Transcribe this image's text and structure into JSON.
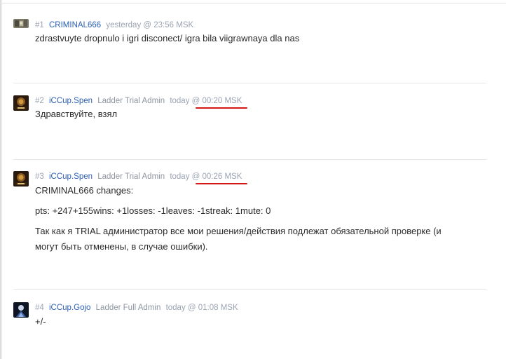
{
  "posts": [
    {
      "num": "#1",
      "user": "CRIMINAL666",
      "role": "",
      "time": "yesterday @ 23:56 MSK",
      "lines": [
        "zdrastvuyte dropnulo i igri disconect/ igra bila viigrawnaya dla nas"
      ]
    },
    {
      "num": "#2",
      "user": "iCCup.Spen",
      "role": "Ladder Trial Admin",
      "time": "today @ 00:20 MSK",
      "lines": [
        "Здравствуйте, взял"
      ]
    },
    {
      "num": "#3",
      "user": "iCCup.Spen",
      "role": "Ladder Trial Admin",
      "time": "today @ 00:26 MSK",
      "lines": [
        "CRIMINAL666 changes:",
        "pts: +247+155wins: +1losses: -1leaves: -1streak: 1mute: 0",
        "Так как я TRIAL администратор все мои решения/действия подлежат обязательной проверке (и",
        "могут быть отменены, в случае ошибки)."
      ]
    },
    {
      "num": "#4",
      "user": "iCCup.Gojo",
      "role": "Ladder Full Admin",
      "time": "today @ 01:08 MSK",
      "lines": [
        "+/-"
      ]
    }
  ]
}
